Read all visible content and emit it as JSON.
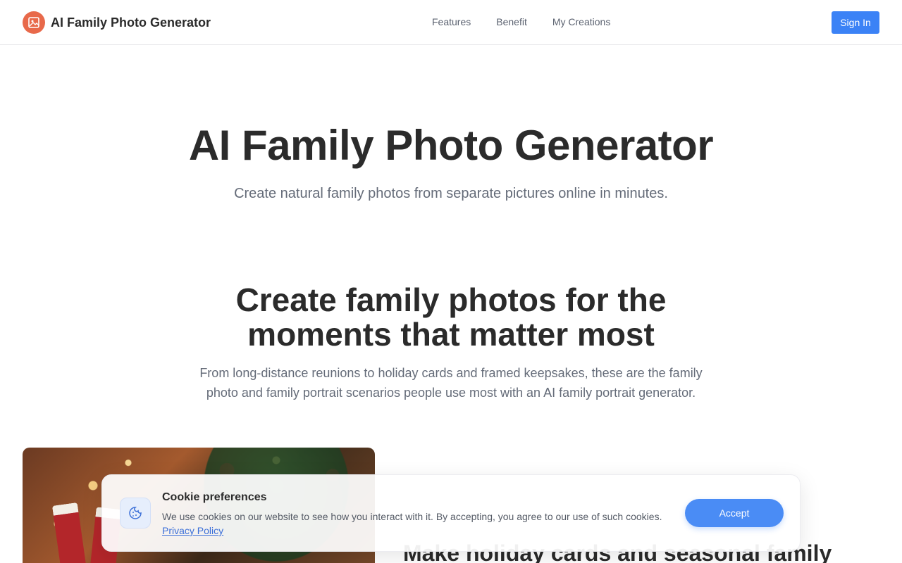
{
  "header": {
    "brand_name": "AI Family Photo Generator",
    "nav": [
      "Features",
      "Benefit",
      "My Creations"
    ],
    "sign_in": "Sign In"
  },
  "hero": {
    "title": "AI Family Photo Generator",
    "subtitle": "Create natural family photos from separate pictures online in minutes."
  },
  "section": {
    "title_line1": "Create family photos for the",
    "title_line2": "moments that matter most",
    "desc_line1": "From long-distance reunions to holiday cards and framed keepsakes, these are the family",
    "desc_line2": "photo and family portrait scenarios people use most with an AI family portrait generator."
  },
  "feature": {
    "title": "Make holiday cards and seasonal family"
  },
  "cookie": {
    "title": "Cookie preferences",
    "text": "We use cookies on our website to see how you interact with it. By accepting, you agree to our use of such cookies.",
    "link": "Privacy Policy",
    "accept": "Accept"
  },
  "colors": {
    "accent": "#3b82f6",
    "brand": "#e8694a"
  }
}
